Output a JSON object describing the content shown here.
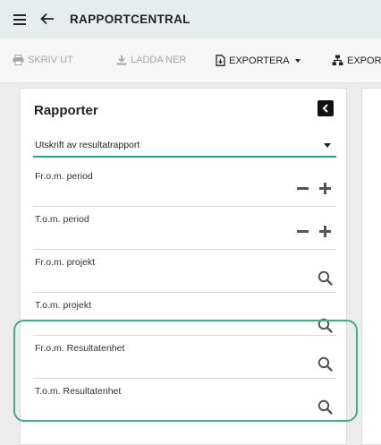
{
  "appbar": {
    "title": "RAPPORTCENTRAL",
    "menu_icon": "hamburger-menu-icon",
    "back_icon": "arrow-left-icon"
  },
  "toolbar": {
    "print_label": "SKRIV UT",
    "download_label": "LADDA NER",
    "export_label": "EXPORTERA",
    "export2_label": "EXPOR"
  },
  "panel": {
    "title": "Rapporter",
    "report_select": {
      "value": "Utskrift av resultatrapport"
    },
    "fields": [
      {
        "label": "Fr.o.m. period",
        "control": "stepper"
      },
      {
        "label": "T.o.m. period",
        "control": "stepper"
      },
      {
        "label": "Fr.o.m. projekt",
        "control": "search"
      },
      {
        "label": "T.o.m. projekt",
        "control": "search"
      },
      {
        "label": "Fr.o.m. Resultatenhet",
        "control": "search"
      },
      {
        "label": "T.o.m. Resultatenhet",
        "control": "search"
      }
    ]
  },
  "colors": {
    "accent": "#1fa58c",
    "highlight": "#3fae88",
    "appbar_bg": "#e7ecee",
    "disabled_text": "#a6a6a6"
  }
}
